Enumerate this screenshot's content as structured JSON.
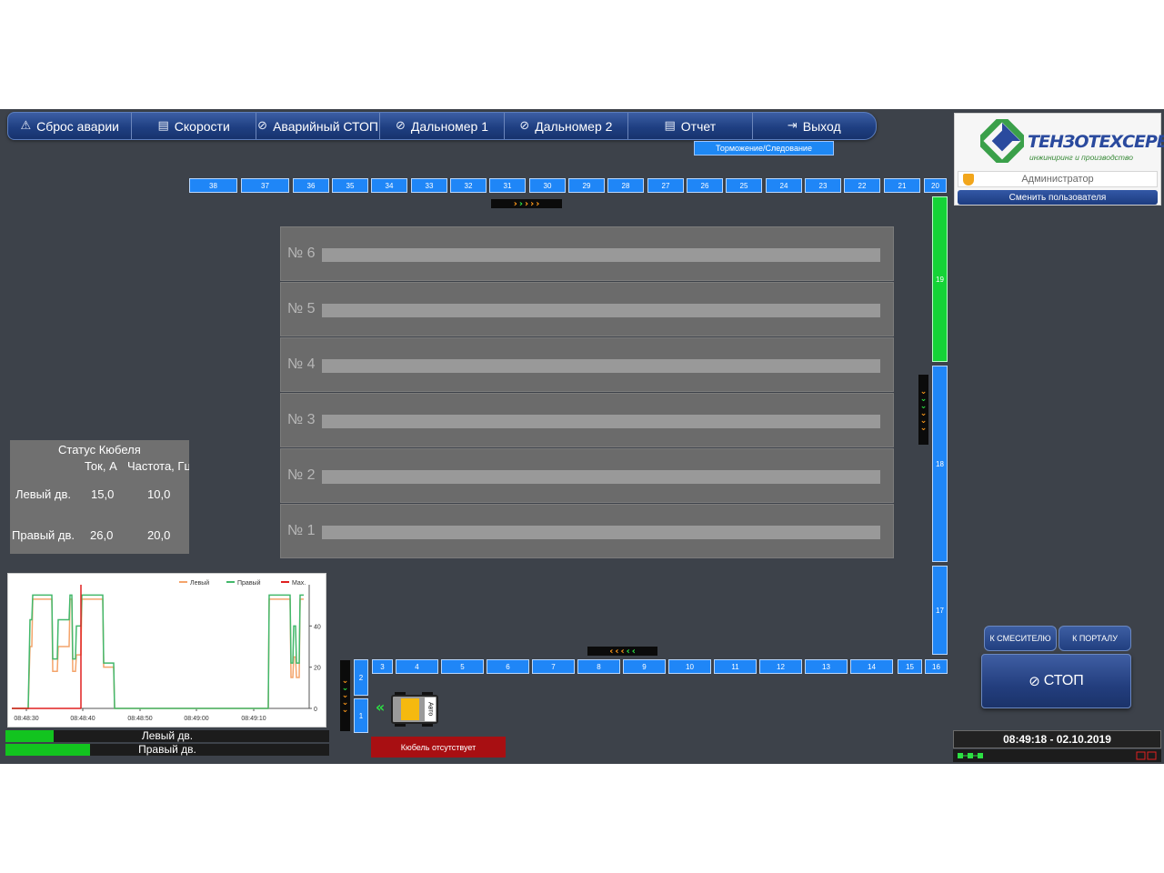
{
  "toolbar": {
    "items": [
      {
        "label": "Сброс аварии",
        "icon": "warning-icon"
      },
      {
        "label": "Скорости",
        "icon": "table-icon"
      },
      {
        "label": "Аварийный СТОП",
        "icon": "stop-icon"
      },
      {
        "label": "Дальномер 1",
        "icon": "stop-icon"
      },
      {
        "label": "Дальномер 2",
        "icon": "stop-icon"
      },
      {
        "label": "Отчет",
        "icon": "table-icon"
      },
      {
        "label": "Выход",
        "icon": "exit-icon"
      }
    ]
  },
  "brake_label": "Торможение/Следование",
  "logo": {
    "title": "ТЕНЗОТЕХСЕРВИС",
    "subtitle": "инжиниринг и производство"
  },
  "user": {
    "name": "Администратор",
    "switch_label": "Сменить пользователя"
  },
  "track": {
    "top": [
      "38",
      "37",
      "36",
      "35",
      "34",
      "33",
      "32",
      "31",
      "30",
      "29",
      "28",
      "27",
      "26",
      "25",
      "24",
      "23",
      "22",
      "21",
      "20"
    ],
    "right": [
      "19",
      "18",
      "17"
    ],
    "bottom": [
      "2",
      "3",
      "4",
      "5",
      "6",
      "7",
      "8",
      "9",
      "10",
      "11",
      "12",
      "13",
      "14",
      "15",
      "16"
    ],
    "start": "1",
    "green_segments": [
      "19"
    ]
  },
  "cells": [
    "№ 6",
    "№ 5",
    "№ 4",
    "№ 3",
    "№ 2",
    "№ 1"
  ],
  "status": {
    "title": "Статус Кюбеля",
    "col_current": "Ток, А",
    "col_freq": "Частота, Гц",
    "left_label": "Левый дв.",
    "left_current": "15,0",
    "left_freq": "10,0",
    "right_label": "Правый дв.",
    "right_current": "26,0",
    "right_freq": "20,0"
  },
  "chart_data": {
    "type": "line",
    "series": [
      {
        "name": "Левый",
        "color": "#f4a46b"
      },
      {
        "name": "Правый",
        "color": "#43b86b"
      },
      {
        "name": "Max.",
        "color": "#e02020"
      }
    ],
    "x_ticks": [
      "08:48:30",
      "08:48:40",
      "08:48:50",
      "08:49:00",
      "08:49:10"
    ],
    "y_ticks": [
      "0",
      "20",
      "40"
    ],
    "ylim": [
      0,
      60
    ],
    "legend": "top-right"
  },
  "motors": [
    {
      "label": "Левый дв.",
      "level": 0.15
    },
    {
      "label": "Правый дв.",
      "level": 0.26
    }
  ],
  "cart": {
    "mode": "Авто"
  },
  "kubel_status": "Кюбель отсутствует",
  "nav": {
    "mixer": "К СМЕСИТЕЛЮ",
    "portal": "К ПОРТАЛУ",
    "stop": "СТОП"
  },
  "datetime": "08:49:18 - 02.10.2019",
  "colors": {
    "segment": "#1f86f7",
    "segment_active": "#15d337",
    "toolbar": "#1f3f82",
    "alarm": "#a80f12"
  }
}
